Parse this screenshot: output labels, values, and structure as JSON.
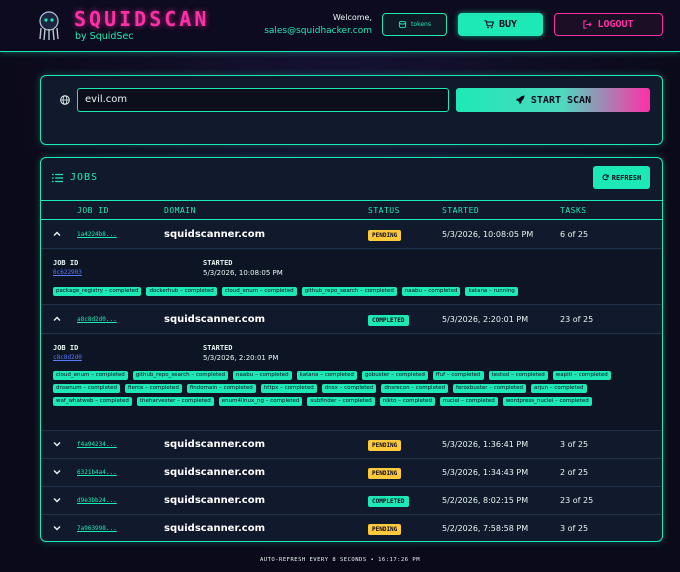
{
  "header": {
    "brand_title": "SQUIDSCAN",
    "brand_sub": "by SquidSec",
    "welcome_label": "Welcome,",
    "email": "sales@squidhacker.com",
    "tokens_label": "tokens",
    "buy_label": "BUY",
    "logout_label": "LOGOUT"
  },
  "scan": {
    "domain_value": "evil.com",
    "start_label": "START SCAN"
  },
  "jobs": {
    "title": "JOBS",
    "refresh_label": "REFRESH",
    "columns": [
      "JOB ID",
      "DOMAIN",
      "STATUS",
      "STARTED",
      "TASKS"
    ],
    "detail_labels": {
      "job_id": "JOB ID",
      "started": "STARTED"
    },
    "rows": [
      {
        "job_id_short": "1a4224b8...",
        "job_id_full": "0c622903",
        "domain": "squidscanner.com",
        "status": "PENDING",
        "started": "5/3/2026, 10:08:05 PM",
        "tasks": "6 of 25",
        "expanded": true,
        "tasks_list": [
          "package_registry – completed",
          "dockerhub – completed",
          "cloud_enum – completed",
          "github_repo_search – completed",
          "naabu – completed",
          "katana – running"
        ]
      },
      {
        "job_id_short": "a8c8d2d0...",
        "job_id_full": "c8c8d2d0",
        "domain": "squidscanner.com",
        "status": "COMPLETED",
        "started": "5/3/2026, 2:20:01 PM",
        "tasks": "23 of 25",
        "expanded": true,
        "tasks_list": [
          "cloud_enum – completed",
          "github_repo_search – completed",
          "naabu – completed",
          "katana – completed",
          "gobuster – completed",
          "ffuf – completed",
          "testssl – completed",
          "wapiti – completed",
          "dnsenum – completed",
          "fierce – completed",
          "findomain – completed",
          "httpx – completed",
          "dnsx – completed",
          "dnsrecon – completed",
          "feroxbuster – completed",
          "arjun – completed",
          "waf_whatweb – completed",
          "theharvester – completed",
          "enum4linux_ng – completed",
          "subfinder – completed",
          "nikto – completed",
          "nuclei – completed",
          "wordpress_nuclei – completed"
        ]
      },
      {
        "job_id_short": "f4a94234...",
        "domain": "squidscanner.com",
        "status": "PENDING",
        "started": "5/3/2026, 1:36:41 PM",
        "tasks": "3 of 25",
        "expanded": false
      },
      {
        "job_id_short": "6321b4a4...",
        "domain": "squidscanner.com",
        "status": "PENDING",
        "started": "5/3/2026, 1:34:43 PM",
        "tasks": "2 of 25",
        "expanded": false
      },
      {
        "job_id_short": "d9e3bb24...",
        "domain": "squidscanner.com",
        "status": "COMPLETED",
        "started": "5/2/2026, 8:02:15 PM",
        "tasks": "23 of 25",
        "expanded": false
      },
      {
        "job_id_short": "7a963998...",
        "domain": "squidscanner.com",
        "status": "PENDING",
        "started": "5/2/2026, 7:58:58 PM",
        "tasks": "3 of 25",
        "expanded": false
      }
    ]
  },
  "footer": "AUTO-REFRESH EVERY 8 SECONDS • 16:17:26 PM",
  "colors": {
    "accent": "#1de9b6",
    "brand": "#ff2fa6",
    "pending": "#ffc93c",
    "background": "#0b0a1a"
  },
  "icons": {
    "logo": "squid-logo-icon",
    "tokens": "coins-icon",
    "buy": "cart-icon",
    "logout": "logout-icon",
    "domain": "globe-icon",
    "scan": "rocket-icon",
    "jobs": "list-icon",
    "refresh": "refresh-icon",
    "row_toggle": "chevron-icon"
  }
}
